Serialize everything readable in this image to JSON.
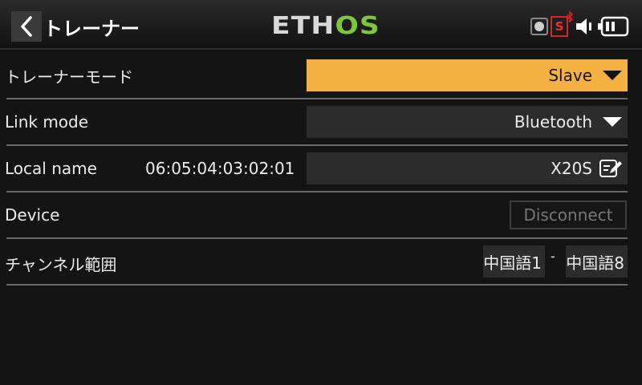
{
  "header": {
    "title": "トレーナー",
    "logo_main": "ETH",
    "logo_accent": "OS",
    "sd_badge": "S",
    "icons": [
      "back-icon",
      "record-icon",
      "bluetooth-icon",
      "speaker-icon",
      "battery-icon"
    ],
    "accent_color": "#f5b042",
    "logo_accent_color": "#7cc83a"
  },
  "rows": {
    "trainer_mode": {
      "label": "トレーナーモード",
      "value": "Slave"
    },
    "link_mode": {
      "label": "Link mode",
      "value": "Bluetooth"
    },
    "local_name": {
      "label": "Local name",
      "address": "06:05:04:03:02:01",
      "value": "X20S"
    },
    "device": {
      "label": "Device",
      "button": "Disconnect"
    },
    "channel_range": {
      "label": "チャンネル範囲",
      "from": "中国語1",
      "separator": "-",
      "to": "中国語8"
    }
  }
}
